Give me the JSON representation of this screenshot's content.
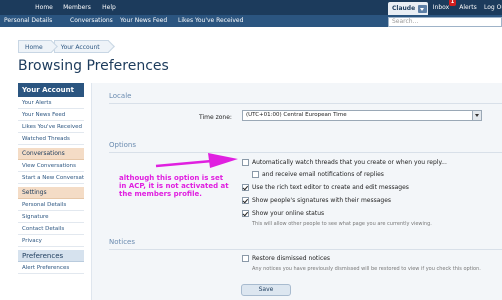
{
  "topnav": {
    "tabs": [
      "Home",
      "Members",
      "Help"
    ],
    "user": "Claude",
    "badge": "1",
    "right_tabs": [
      "Inbox",
      "Alerts",
      "Log Out"
    ]
  },
  "subnav": {
    "links": [
      "Personal Details",
      "Conversations",
      "Your News Feed",
      "Likes You've Received"
    ],
    "search_placeholder": "Search..."
  },
  "breadcrumb": [
    "Home",
    "Your Account"
  ],
  "page_title": "Browsing Preferences",
  "sidebar": {
    "account_header": "Your Account",
    "account_items": [
      "Your Alerts",
      "Your News Feed",
      "Likes You've Received",
      "Watched Threads"
    ],
    "conversations_header": "Conversations",
    "conversations_items": [
      "View Conversations",
      "Start a New Conversation"
    ],
    "settings_header": "Settings",
    "settings_items": [
      "Personal Details",
      "Signature",
      "Contact Details",
      "Privacy"
    ],
    "preferences_header": "Preferences",
    "preferences_items": [
      "Alert Preferences"
    ]
  },
  "locale": {
    "header": "Locale",
    "timezone_label": "Time zone:",
    "timezone_value": "(UTC+01:00) Central European Time"
  },
  "options": {
    "header": "Options",
    "items": [
      {
        "label": "Automatically watch threads that you create or when you reply...",
        "checked": false
      },
      {
        "label": "and receive email notifications of replies",
        "checked": false
      },
      {
        "label": "Use the rich text editor to create and edit messages",
        "checked": true
      },
      {
        "label": "Show people's signatures with their messages",
        "checked": true
      },
      {
        "label": "Show your online status",
        "checked": true
      }
    ],
    "online_hint": "This will allow other people to see what page you are currently viewing."
  },
  "annotation": "although this option is set in ACP, it is not activated at the members profile.",
  "notices": {
    "header": "Notices",
    "restore_label": "Restore dismissed notices",
    "restore_hint": "Any notices you have previously dismissed will be restored to view if you check this option."
  },
  "save_label": "Save",
  "colors": {
    "nav": "#1c3b5c",
    "subnav": "#2b5580",
    "annotation": "#e020e0"
  }
}
